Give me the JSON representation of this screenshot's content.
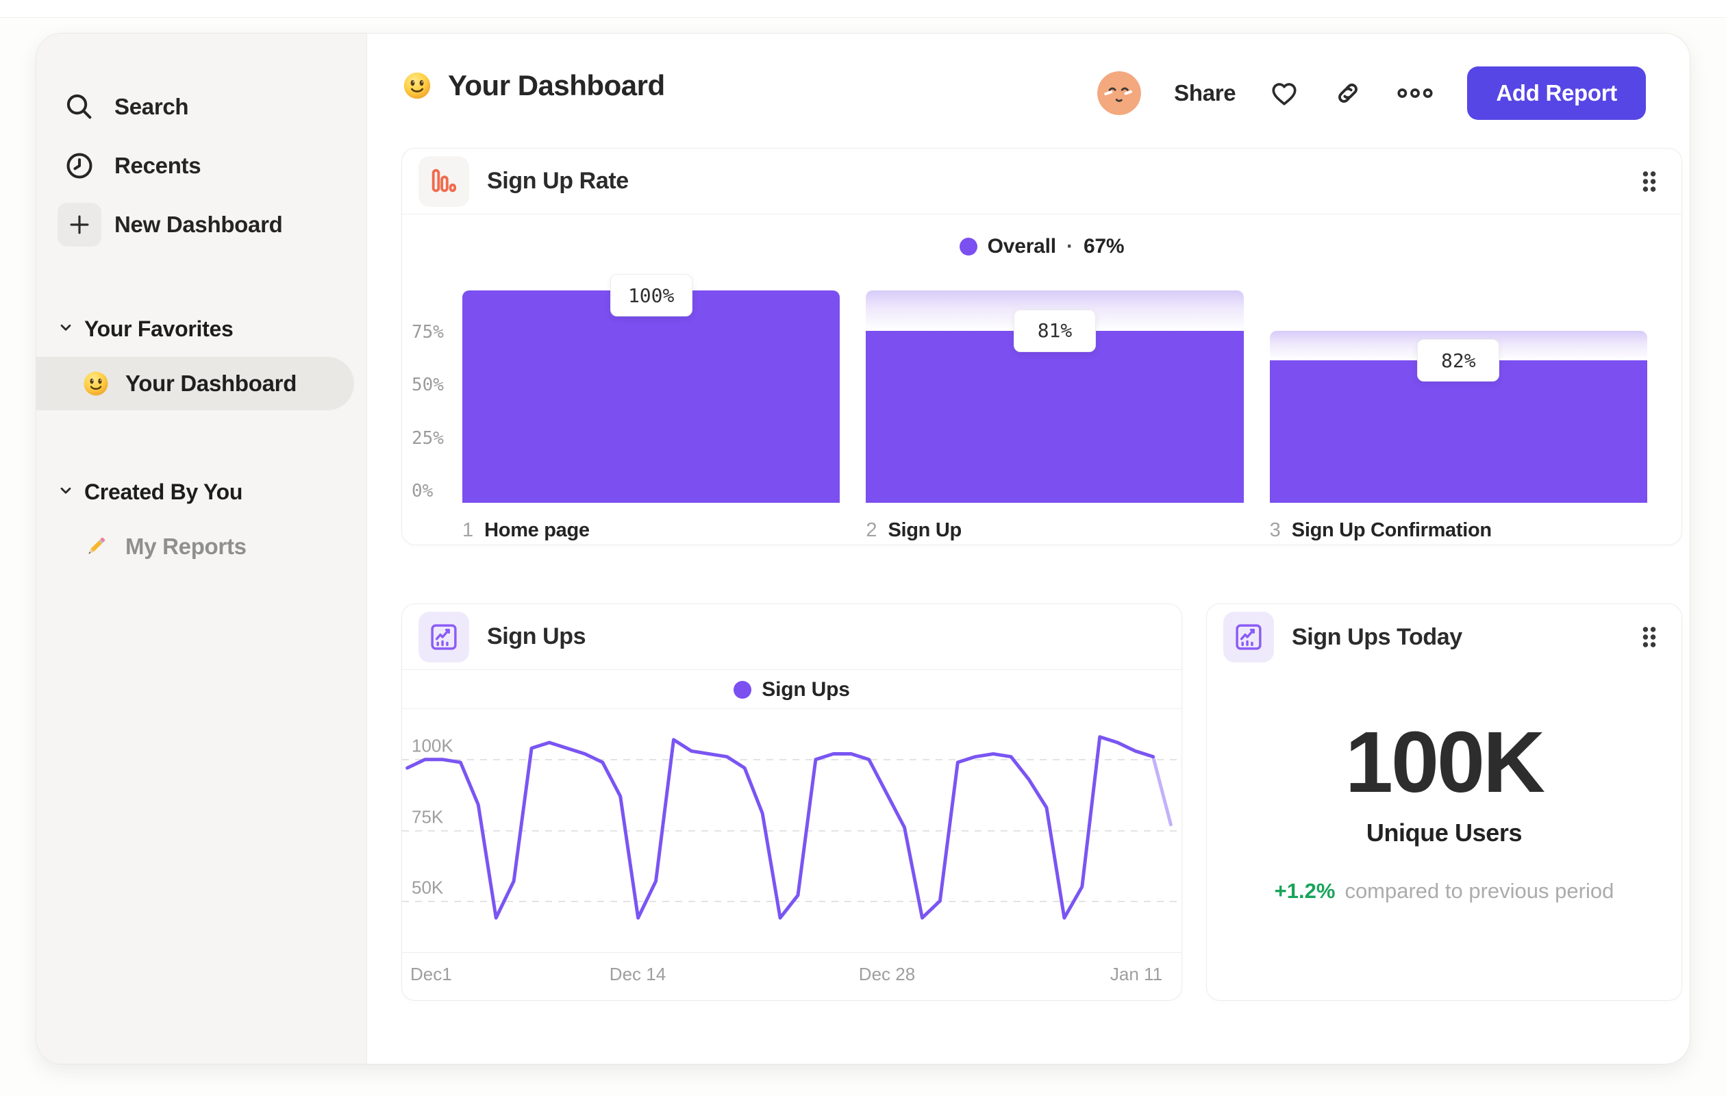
{
  "header": {
    "title": "Your Dashboard",
    "share": "Share",
    "add_report": "Add Report"
  },
  "sidebar": {
    "nav": [
      {
        "label": "Search",
        "icon": "search-icon"
      },
      {
        "label": "Recents",
        "icon": "clock-icon"
      },
      {
        "label": "New Dashboard",
        "icon": "plus-icon"
      }
    ],
    "sections": [
      {
        "label": "Your Favorites",
        "items": [
          {
            "label": "Your Dashboard",
            "icon": "smiley-emoji",
            "selected": true
          }
        ]
      },
      {
        "label": "Created By You",
        "items": [
          {
            "label": "My Reports",
            "icon": "pencil-emoji",
            "selected": false
          }
        ]
      }
    ]
  },
  "cards": {
    "sign_up_rate": {
      "title": "Sign Up Rate",
      "legend_label": "Overall",
      "legend_sep": "·",
      "legend_value": "67%"
    },
    "sign_ups": {
      "title": "Sign Ups",
      "legend_label": "Sign Ups"
    },
    "sign_ups_today": {
      "title": "Sign Ups Today",
      "value": "100K",
      "unit_label": "Unique Users",
      "delta": "+1.2%",
      "comparison": "compared to previous period"
    }
  },
  "chart_data": [
    {
      "type": "bar",
      "subtype": "funnel",
      "title": "Sign Up Rate",
      "legend": "Overall · 67%",
      "categories": [
        "Home page",
        "Sign Up",
        "Sign Up Confirmation"
      ],
      "step_numbers": [
        "1",
        "2",
        "3"
      ],
      "step_conversion_labels": [
        "100%",
        "81%",
        "82%"
      ],
      "solid_percent": [
        100,
        81,
        67
      ],
      "gradient_top_percent": [
        100,
        100,
        81
      ],
      "ytick_labels": [
        "75%",
        "50%",
        "25%",
        "0%"
      ],
      "ytick_values": [
        75,
        50,
        25,
        0
      ],
      "ylim": [
        0,
        100
      ],
      "grid": false,
      "legend_position": "top-center"
    },
    {
      "type": "line",
      "title": "Sign Ups",
      "legend": "Sign Ups",
      "x_ticks": [
        {
          "label": "Dec1",
          "day": 0
        },
        {
          "label": "Dec 14",
          "day": 13
        },
        {
          "label": "Dec 28",
          "day": 27
        },
        {
          "label": "Jan 11",
          "day": 41
        }
      ],
      "yticks": [
        {
          "label": "100K",
          "value": 100
        },
        {
          "label": "75K",
          "value": 75
        },
        {
          "label": "50K",
          "value": 50
        }
      ],
      "unit": "K",
      "values": [
        97,
        100,
        100,
        99,
        84,
        44,
        57,
        104,
        106,
        104,
        102,
        99,
        87,
        44,
        57,
        107,
        103,
        102,
        101,
        97,
        81,
        44,
        52,
        100,
        102,
        102,
        100,
        88,
        76,
        44,
        50,
        99,
        101,
        102,
        101,
        93,
        83,
        44,
        55,
        108,
        106,
        103,
        101,
        77
      ],
      "faded_tail_segments": 1,
      "ylim": [
        40,
        112
      ],
      "grid": "dashed-horizontal",
      "legend_position": "top-center"
    }
  ],
  "colors": {
    "purple": "#7b4ff0",
    "line_purple": "#7a55f2",
    "button_purple": "#5646e5",
    "orange": "#f16a4c",
    "green": "#18a45a",
    "gradient_top": "#d7cbf8"
  }
}
